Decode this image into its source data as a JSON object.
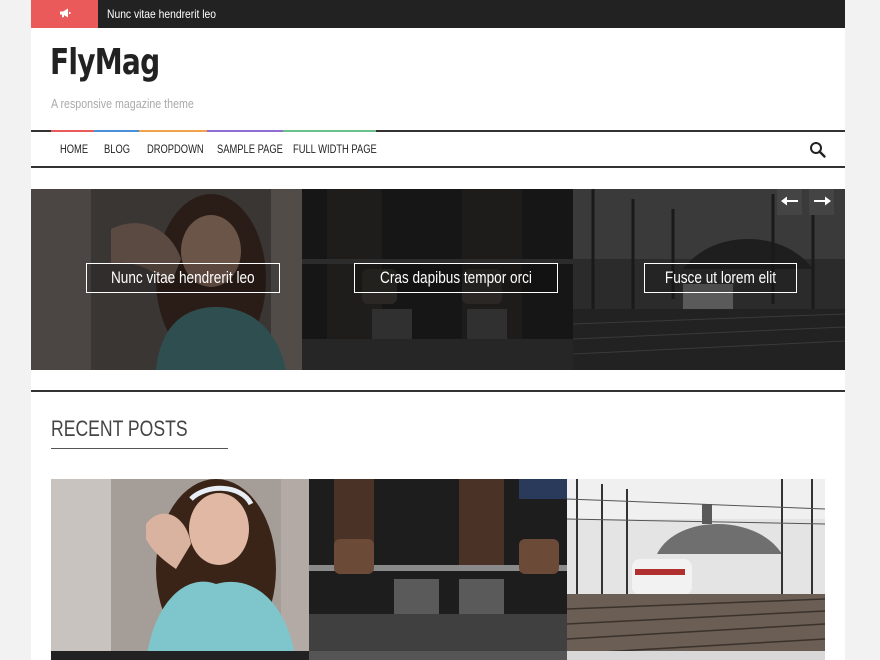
{
  "ticker": {
    "icon": "megaphone-icon",
    "badge_color": "#ea5a5a",
    "headline": "Nunc vitae hendrerit leo"
  },
  "site": {
    "title": "FlyMag",
    "tagline": "A responsive magazine theme"
  },
  "nav": {
    "items": [
      {
        "label": "HOME"
      },
      {
        "label": "BLOG"
      },
      {
        "label": "DROPDOWN"
      },
      {
        "label": "SAMPLE PAGE"
      },
      {
        "label": "FULL WIDTH PAGE"
      }
    ],
    "accent_colors": [
      "#ea5a5a",
      "#4a90d9",
      "#f0a34a",
      "#8e6fd1",
      "#6cc08b"
    ],
    "search_icon": "search-icon"
  },
  "slider": {
    "slides": [
      {
        "caption": "Nunc vitae hendrerit leo"
      },
      {
        "caption": "Cras dapibus tempor orci"
      },
      {
        "caption": "Fusce ut lorem elit"
      }
    ],
    "prev_icon": "arrow-left-icon",
    "next_icon": "arrow-right-icon"
  },
  "recent_posts": {
    "heading": "RECENT POSTS"
  }
}
